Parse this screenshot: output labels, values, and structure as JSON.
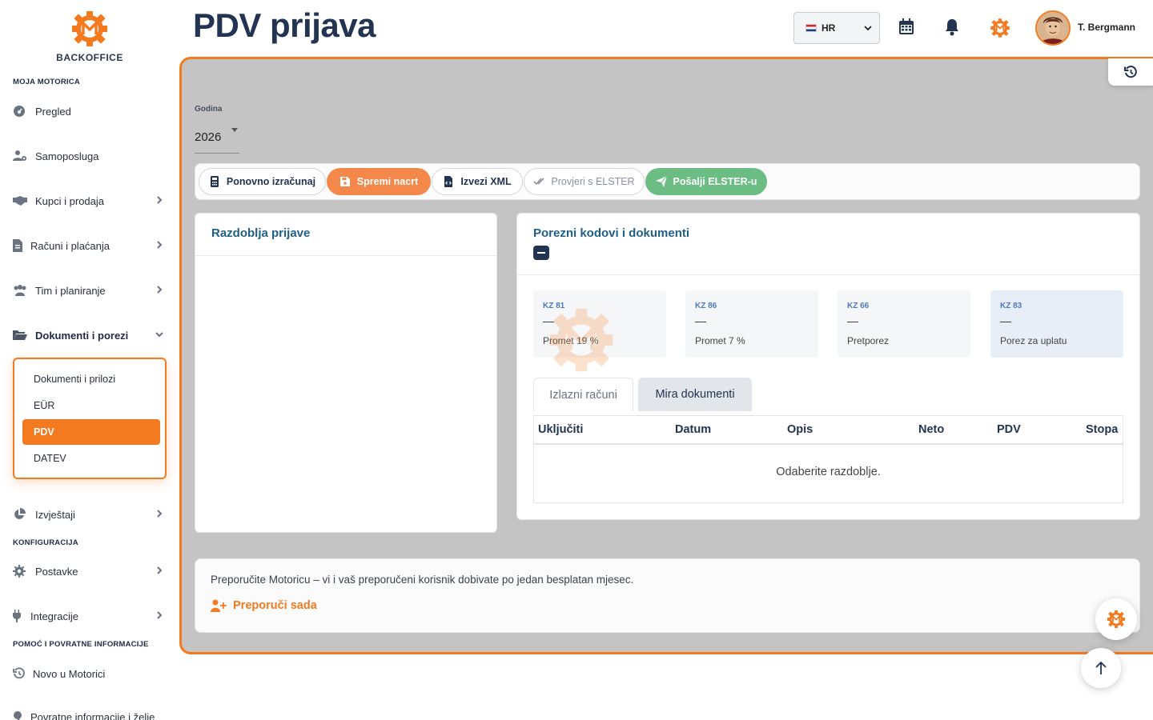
{
  "sidebar": {
    "brand": "BACKOFFICE",
    "sections": {
      "moja": "MOJA MOTORICA",
      "konfig": "KONFIGURACIJA",
      "pomoc": "POMOĆ I POVRATNE INFORMACIJE"
    },
    "items": {
      "pregled": "Pregled",
      "samoposluga": "Samoposluga",
      "kupci": "Kupci i prodaja",
      "racuni": "Računi i plaćanja",
      "tim": "Tim i planiranje",
      "dokumenti": "Dokumenti i porezi",
      "izvjestaji": "Izvještaji",
      "postavke": "Postavke",
      "integracije": "Integracije",
      "novo": "Novo u Motorici",
      "povratne": "Povratne informacije i želje"
    },
    "submenu": [
      "Dokumenti i prilozi",
      "EÜR",
      "PDV",
      "DATEV"
    ]
  },
  "header": {
    "title": "PDV prijava",
    "language": "HR",
    "user_name": "T. Bergmann"
  },
  "filters": {
    "year_label": "Godina",
    "year_value": "2026"
  },
  "toolbar": {
    "recalculate": "Ponovno izračunaj",
    "save_draft": "Spremi nacrt",
    "export_xml": "Izvezi XML",
    "check_elster": "Provjeri s ELSTER",
    "send_elster": "Pošalji ELSTER-u"
  },
  "periods_card": {
    "title": "Razdoblja prijave"
  },
  "codes_card": {
    "title": "Porezni kodovi i dokumenti",
    "kz": [
      {
        "code": "KZ 81",
        "value": "—",
        "desc": "Promet 19 %"
      },
      {
        "code": "KZ 86",
        "value": "—",
        "desc": "Promet 7 %"
      },
      {
        "code": "KZ 66",
        "value": "—",
        "desc": "Pretporez"
      },
      {
        "code": "KZ 83",
        "value": "—",
        "desc": "Porez za uplatu"
      }
    ],
    "tabs": [
      "Izlazni računi",
      "Mira dokumenti"
    ],
    "columns": [
      "Uključiti",
      "Datum",
      "Opis",
      "Neto",
      "PDV",
      "Stopa"
    ],
    "empty_message": "Odaberite razdoblje."
  },
  "referral": {
    "text": "Preporučite Motoricu – vi i vaš preporučeni korisnik dobivate po jedan besplatan mjesec.",
    "link": "Preporuči sada"
  },
  "colors": {
    "accent": "#f47a20",
    "navy": "#233452",
    "green": "#6cbd84",
    "link_blue": "#1f5f87"
  }
}
